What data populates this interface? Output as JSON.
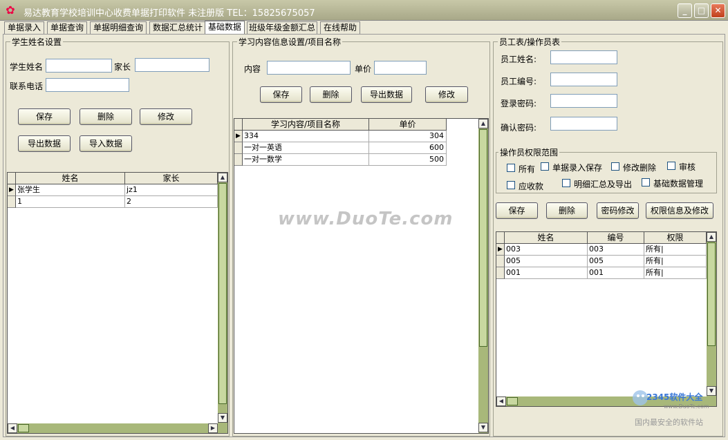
{
  "window": {
    "title": "易达教育学校培训中心收费单据打印软件 未注册版   TEL：15825675057",
    "minimize": "_",
    "maximize": "□",
    "close": "✕"
  },
  "tabs": [
    "单据录入",
    "单据查询",
    "单据明细查询",
    "数据汇总统计",
    "基础数据",
    "班级年级金额汇总",
    "在线帮助"
  ],
  "active_tab": "基础数据",
  "student": {
    "group_title": "学生姓名设置",
    "name_label": "学生姓名",
    "parent_label": "家长",
    "phone_label": "联系电话",
    "buttons": {
      "save": "保存",
      "delete": "删除",
      "edit": "修改",
      "export": "导出数据",
      "import": "导入数据"
    },
    "grid": {
      "columns": [
        "姓名",
        "家长"
      ],
      "rows": [
        [
          "张学生",
          "jz1"
        ],
        [
          "1",
          "2"
        ]
      ]
    }
  },
  "course": {
    "group_title": "学习内容信息设置/项目名称",
    "content_label": "内容",
    "price_label": "单价",
    "buttons": {
      "save": "保存",
      "delete": "删除",
      "export": "导出数据",
      "edit": "修改"
    },
    "grid": {
      "columns": [
        "学习内容/项目名称",
        "单价"
      ],
      "rows": [
        [
          "334",
          "304"
        ],
        [
          "一对一英语",
          "600"
        ],
        [
          "一对一数学",
          "500"
        ]
      ]
    }
  },
  "staff": {
    "group_title": "员工表/操作员表",
    "name_label": "员工姓名:",
    "id_label": "员工编号:",
    "password_label": "登录密码:",
    "confirm_label": "确认密码:",
    "perm_group_title": "操作员权限范围",
    "permissions": [
      "所有",
      "单据录入保存",
      "修改删除",
      "审核",
      "应收款",
      "明细汇总及导出",
      "基础数据管理"
    ],
    "buttons": {
      "save": "保存",
      "delete": "删除",
      "change_password": "密码修改",
      "perm_edit": "权限信息及修改"
    },
    "grid": {
      "columns": [
        "姓名",
        "编号",
        "权限"
      ],
      "rows": [
        [
          "003",
          "003",
          "所有|"
        ],
        [
          "005",
          "005",
          "所有|"
        ],
        [
          "001",
          "001",
          "所有|"
        ]
      ]
    }
  },
  "watermark": "www.DuoTe.com",
  "logo": {
    "name": "2345软件大全",
    "url": "www.DuoTe.com",
    "slogan": "国内最安全的软件站"
  }
}
